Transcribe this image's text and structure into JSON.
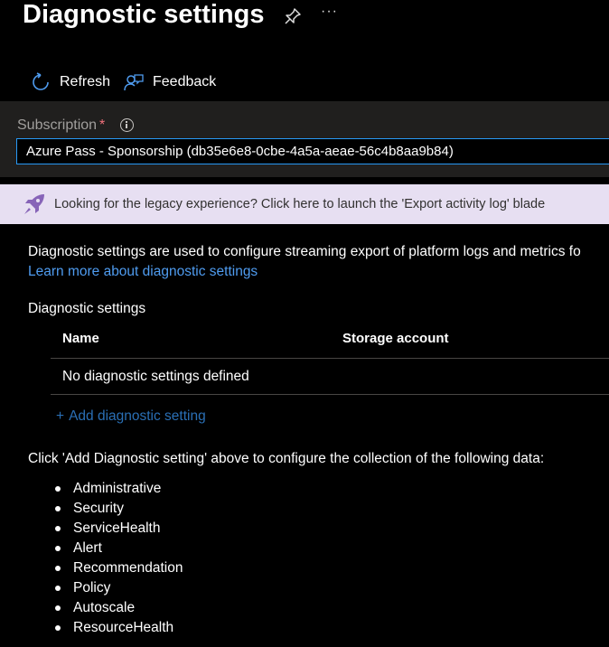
{
  "header": {
    "title": "Diagnostic settings",
    "more_label": "···"
  },
  "toolbar": {
    "refresh_label": "Refresh",
    "feedback_label": "Feedback"
  },
  "subscription": {
    "label": "Subscription",
    "required_marker": "*",
    "value": "Azure Pass - Sponsorship (db35e6e8-0cbe-4a5a-aeae-56c4b8aa9b84)"
  },
  "banner": {
    "text": "Looking for the legacy experience? Click here to launch the 'Export activity log' blade"
  },
  "main": {
    "description": "Diagnostic settings are used to configure streaming export of platform logs and metrics fo",
    "learn_more_link": "Learn more about diagnostic settings",
    "section_title": "Diagnostic settings",
    "table": {
      "columns": [
        "Name",
        "Storage account"
      ],
      "empty_text": "No diagnostic settings defined"
    },
    "add_setting_label": "Add diagnostic setting",
    "add_setting_plus": "+",
    "instructions": "Click 'Add Diagnostic setting' above to configure the collection of the following data:",
    "data_categories": [
      "Administrative",
      "Security",
      "ServiceHealth",
      "Alert",
      "Recommendation",
      "Policy",
      "Autoscale",
      "ResourceHealth"
    ]
  },
  "colors": {
    "background": "#000000",
    "accent_link": "#4f9cf0",
    "banner_bg": "#e7dff2",
    "rocket": "#8764b8",
    "input_border": "#2899f5"
  }
}
